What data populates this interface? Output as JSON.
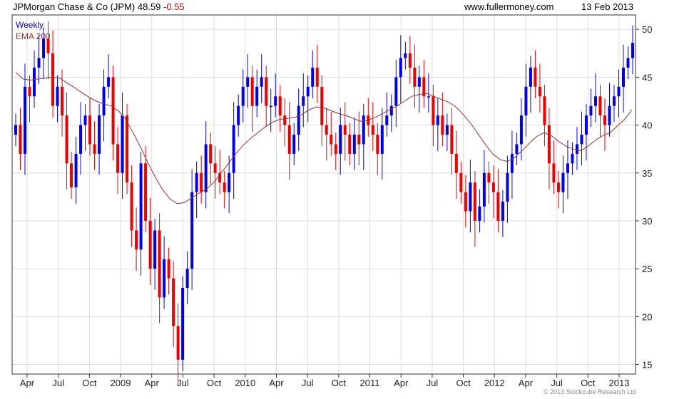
{
  "header": {
    "title": "JPMorgan Chase & Co (JPM) 48.59",
    "change": "-0.55",
    "website": "www.fullermoney.com",
    "date": "13 Feb 2013"
  },
  "legend": {
    "weekly": "Weekly",
    "ema": "EMA 200"
  },
  "copyright": "© 2013 Stockcube Research Ltd",
  "colors": {
    "up": "#0000ee",
    "down": "#ee0000",
    "ema": "#993333",
    "grid": "#dddddd",
    "axis": "#333333"
  },
  "chart_data": {
    "type": "candlestick",
    "y_ticks": [
      15,
      20,
      25,
      30,
      35,
      40,
      45,
      50
    ],
    "ylim": [
      14,
      51.5
    ],
    "x_ticks": [
      "Apr",
      "Jul",
      "Oct",
      "2009",
      "Apr",
      "Jul",
      "Oct",
      "2010",
      "Apr",
      "Jul",
      "Oct",
      "2011",
      "Apr",
      "Jul",
      "Oct",
      "2012",
      "Apr",
      "Jul",
      "Oct",
      "2013"
    ],
    "grid": true,
    "series": [
      {
        "name": "Weekly",
        "closes": [
          40,
          37,
          44,
          43,
          46,
          47,
          49,
          47.5,
          42,
          44,
          41,
          36,
          33.5,
          37,
          40,
          41,
          38,
          37,
          41,
          44,
          45,
          38,
          35,
          41,
          34,
          29,
          27,
          36,
          30,
          25,
          29,
          22,
          26,
          24,
          19,
          15.5,
          23,
          25,
          33,
          35,
          33,
          38,
          36,
          35,
          34,
          33,
          35,
          40,
          42,
          44,
          45,
          42,
          44,
          45,
          42,
          42,
          43,
          41,
          40,
          37,
          39,
          42,
          43,
          44,
          46,
          44,
          40,
          39,
          38,
          37,
          40,
          39,
          37,
          39,
          38,
          41,
          40,
          39,
          37,
          40,
          41,
          42,
          45,
          47,
          47.5,
          46,
          44,
          45,
          43,
          43,
          40,
          41,
          39,
          40,
          37,
          35,
          33,
          31,
          34,
          30,
          31.5,
          35,
          34,
          33,
          30,
          32,
          35,
          37,
          38,
          41,
          44,
          46,
          44,
          43,
          40,
          36,
          34,
          33,
          35,
          36,
          37,
          38,
          39,
          41,
          42,
          43,
          41,
          40,
          42,
          43,
          44,
          46,
          47,
          48.59
        ],
        "ema": [
          45.5,
          44.8,
          44.7,
          44.8,
          44.9,
          45,
          44.9,
          44.4,
          43.9,
          43.4,
          42.9,
          42.5,
          42.2,
          42,
          41.5,
          40.6,
          39.2,
          37.7,
          36.1,
          34.6,
          33.3,
          32.3,
          31.8,
          31.9,
          32.4,
          32.9,
          33.3,
          34,
          35,
          36,
          37,
          37.9,
          38.6,
          39.2,
          39.8,
          40.3,
          40.6,
          40.7,
          40.8,
          41.1,
          41.6,
          41.9,
          41.8,
          41.5,
          41.2,
          41,
          40.7,
          40.4,
          40.5,
          40.8,
          41.2,
          41.6,
          42,
          42.5,
          43,
          43.2,
          43.3,
          43,
          42.7,
          42.4,
          41.9,
          41.1,
          40.2,
          39.1,
          38,
          37,
          36.4,
          36.2,
          36.6,
          37.3,
          38.1,
          38.8,
          39.2,
          38.9,
          38.3,
          37.8,
          37.5,
          37.3,
          37.8,
          38.4,
          38.9,
          39.2,
          39.9,
          40.6,
          41.6
        ]
      }
    ]
  }
}
